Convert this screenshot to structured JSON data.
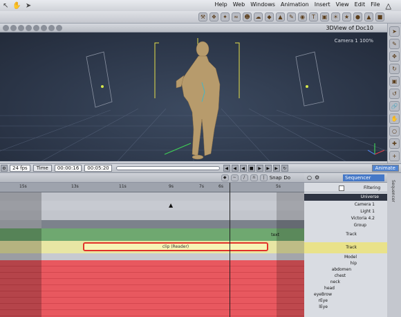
{
  "menubar": {
    "menus": [
      "File",
      "Edit",
      "View",
      "Insert",
      "Animation",
      "Windows",
      "Web",
      "Help"
    ]
  },
  "viewport": {
    "title": "3DView of Doc10",
    "camera_label": "Camera 1 100%"
  },
  "transport": {
    "fps": "24 fps",
    "time_mode": "Time",
    "current_time": "00:00:16",
    "end_time": "00:05:20",
    "animate_button": "Animate"
  },
  "timeline": {
    "toolbar_do": "Do",
    "toolbar_snap": "Snap",
    "ruler_ticks": [
      "15s",
      "13s",
      "11s",
      "9s",
      "7s",
      "6s",
      "5s"
    ],
    "clip_label": "clip (Reader)",
    "track_label": "Track",
    "text_label": "text"
  },
  "sequencer": {
    "select": "Sequencer",
    "filtering_label": "Filtering",
    "sidebar_label": "Sequencer",
    "nodes": [
      {
        "label": "Universe",
        "indent": 0
      },
      {
        "label": "Camera 1",
        "indent": 1
      },
      {
        "label": "Light 1",
        "indent": 1
      },
      {
        "label": "Victoria 4.2",
        "indent": 1
      },
      {
        "label": "Group",
        "indent": 2
      },
      {
        "label": "Track",
        "indent": 3
      },
      {
        "label": "Track",
        "indent": 3
      },
      {
        "label": "Model",
        "indent": 2
      },
      {
        "label": "hip",
        "indent": 2
      },
      {
        "label": "abdomen",
        "indent": 3
      },
      {
        "label": "chest",
        "indent": 4
      },
      {
        "label": "neck",
        "indent": 5
      },
      {
        "label": "head",
        "indent": 6
      },
      {
        "label": "eyeBrow",
        "indent": 6
      },
      {
        "label": "rEye",
        "indent": 7
      },
      {
        "label": "lEye",
        "indent": 7
      }
    ]
  },
  "colors": {
    "viewport_bg": "#2e3a4f",
    "track_green": "#6fa870",
    "track_yellow": "#e8e6a4",
    "track_red": "#e8585f",
    "clip_border": "#e2322a",
    "highlight_row": "#e9e28a"
  }
}
